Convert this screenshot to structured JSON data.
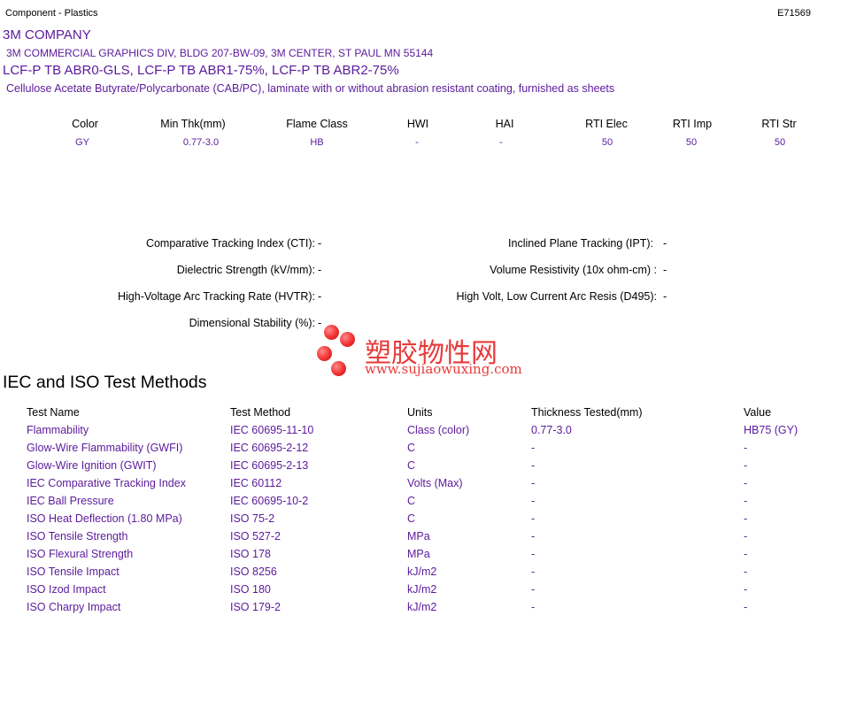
{
  "header": {
    "category": "Component - Plastics",
    "file_number": "E71569",
    "company": "3M COMPANY",
    "address": "3M COMMERCIAL GRAPHICS DIV, BLDG 207-BW-09, 3M CENTER, ST PAUL MN   55144",
    "grades": "LCF-P TB ABR0-GLS, LCF-P TB ABR1-75%, LCF-P TB ABR2-75%",
    "description": "Cellulose Acetate Butyrate/Polycarbonate (CAB/PC), laminate with or without abrasion resistant coating, furnished as sheets"
  },
  "ratings": {
    "columns": [
      "Color",
      "Min Thk(mm)",
      "Flame Class",
      "HWI",
      "HAI",
      "RTI Elec",
      "RTI Imp",
      "RTI Str"
    ],
    "values": [
      "GY",
      "0.77-3.0",
      "HB",
      "-",
      "-",
      "50",
      "50",
      "50"
    ]
  },
  "properties": {
    "left": [
      {
        "label": "Comparative Tracking Index (CTI):",
        "value": "-"
      },
      {
        "label": "Dielectric Strength (kV/mm):",
        "value": "-"
      },
      {
        "label": "High-Voltage Arc Tracking Rate (HVTR):",
        "value": "-"
      },
      {
        "label": "Dimensional Stability (%):",
        "value": "-"
      }
    ],
    "right": [
      {
        "label": "Inclined Plane Tracking (IPT):",
        "value": "-"
      },
      {
        "label": "Volume Resistivity (10x ohm-cm) :",
        "value": "-"
      },
      {
        "label": "High Volt, Low Current Arc Resis (D495):",
        "value": "-"
      }
    ]
  },
  "watermark": {
    "chinese": "塑胶物性网",
    "url": "www.sujiaowuxing.com"
  },
  "tests": {
    "title": "IEC and ISO Test Methods",
    "columns": [
      "Test Name",
      "Test Method",
      "Units",
      "Thickness Tested(mm)",
      "Value"
    ],
    "rows": [
      [
        "Flammability",
        "IEC 60695-11-10",
        "Class (color)",
        "0.77-3.0",
        "HB75 (GY)"
      ],
      [
        "Glow-Wire Flammability (GWFI)",
        "IEC 60695-2-12",
        "C",
        "-",
        "-"
      ],
      [
        "Glow-Wire Ignition (GWIT)",
        "IEC 60695-2-13",
        "C",
        "-",
        "-"
      ],
      [
        "IEC Comparative Tracking Index",
        "IEC 60112",
        "Volts (Max)",
        "-",
        "-"
      ],
      [
        "IEC Ball Pressure",
        "IEC 60695-10-2",
        "C",
        "-",
        "-"
      ],
      [
        "ISO Heat Deflection (1.80 MPa)",
        "ISO 75-2",
        "C",
        "-",
        "-"
      ],
      [
        "ISO Tensile Strength",
        "ISO 527-2",
        "MPa",
        "-",
        "-"
      ],
      [
        "ISO Flexural Strength",
        "ISO 178",
        "MPa",
        "-",
        "-"
      ],
      [
        "ISO Tensile Impact",
        "ISO 8256",
        "kJ/m2",
        "-",
        "-"
      ],
      [
        "ISO Izod Impact",
        "ISO 180",
        "kJ/m2",
        "-",
        "-"
      ],
      [
        "ISO Charpy Impact",
        "ISO 179-2",
        "kJ/m2",
        "-",
        "-"
      ]
    ]
  }
}
